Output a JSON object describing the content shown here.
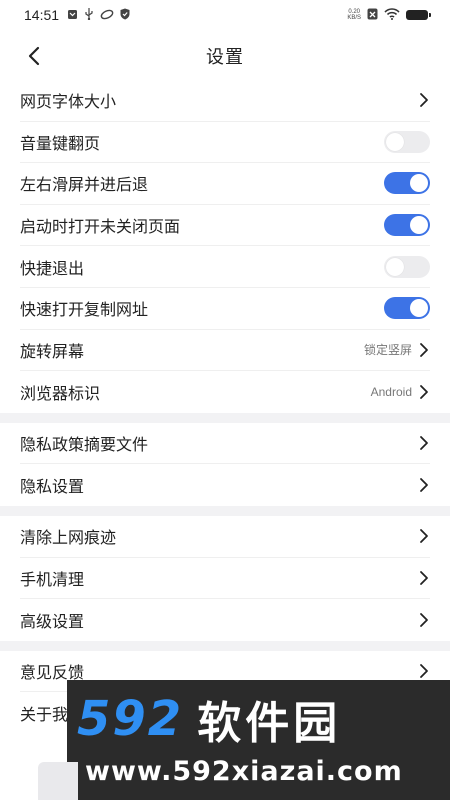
{
  "status_bar": {
    "time": "14:51",
    "net_speed_value": "0.20",
    "net_speed_unit": "KB/S",
    "icons": [
      "notification-icon",
      "usb-icon",
      "sync-icon",
      "shield-icon",
      "sim-icon",
      "wifi-icon",
      "battery-icon"
    ]
  },
  "header": {
    "title": "设置",
    "back_icon": "chevron-left-icon"
  },
  "sections": [
    {
      "rows": [
        {
          "label": "网页字体大小",
          "control": "chevron"
        },
        {
          "label": "音量键翻页",
          "control": "toggle",
          "on": false
        },
        {
          "label": "左右滑屏并进后退",
          "control": "toggle",
          "on": true
        },
        {
          "label": "启动时打开未关闭页面",
          "control": "toggle",
          "on": true
        },
        {
          "label": "快捷退出",
          "control": "toggle",
          "on": false
        },
        {
          "label": "快速打开复制网址",
          "control": "toggle",
          "on": true
        },
        {
          "label": "旋转屏幕",
          "value": "锁定竖屏",
          "control": "chevron"
        },
        {
          "label": "浏览器标识",
          "value": "Android",
          "control": "chevron"
        }
      ]
    },
    {
      "rows": [
        {
          "label": "隐私政策摘要文件",
          "control": "chevron"
        },
        {
          "label": "隐私设置",
          "control": "chevron"
        }
      ]
    },
    {
      "rows": [
        {
          "label": "清除上网痕迹",
          "control": "chevron"
        },
        {
          "label": "手机清理",
          "control": "chevron"
        },
        {
          "label": "高级设置",
          "control": "chevron"
        }
      ]
    },
    {
      "rows": [
        {
          "label": "意见反馈",
          "control": "chevron"
        },
        {
          "label": "关于我",
          "control": "chevron"
        }
      ]
    }
  ],
  "watermark": {
    "number": "592",
    "brand": "软件园",
    "url": "www.592xiazai.com"
  },
  "colors": {
    "toggle_on": "#3d73e6",
    "toggle_off": "#ececee",
    "section_divider": "#f2f2f4",
    "watermark_bg": "#2b2b2b",
    "watermark_blue": "#2f8ff3"
  }
}
